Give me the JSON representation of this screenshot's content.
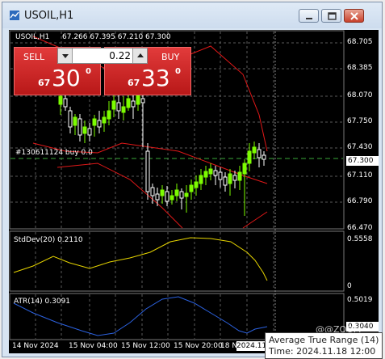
{
  "window": {
    "title": "USOIL,H1",
    "buttons": [
      "minimize",
      "restore",
      "close"
    ]
  },
  "chart_header": {
    "symbol": "USOIL,H1",
    "ohlc": "67.266 67.395 67.210 67.300",
    "position_label": "#130611124 buy 0.0"
  },
  "trade_panel": {
    "sell_label": "SELL",
    "buy_label": "BUY",
    "lot_value": "0.22",
    "sell_price": {
      "prefix": "67",
      "big": "30",
      "sup": "0"
    },
    "buy_price": {
      "prefix": "67",
      "big": "33",
      "sup": "0"
    }
  },
  "price_axis": {
    "labels": [
      "68.705",
      "68.385",
      "68.070",
      "67.750",
      "67.430",
      "67.110",
      "66.790",
      "66.470"
    ],
    "current": "67.300"
  },
  "stddev": {
    "label": "StdDev(20) 0.2110",
    "axis_top": "0.5558",
    "axis_bottom": "0"
  },
  "atr": {
    "label": "ATR(14) 0.3091",
    "axis_top": "0.5019",
    "axis_current": "0.3040"
  },
  "time_axis": {
    "labels": [
      "14 Nov 2024",
      "15 Nov 04:00",
      "15 Nov 12:00",
      "15 Nov 20:00",
      "18 N"
    ],
    "highlight": "2024.11.18 12:00"
  },
  "tooltip": {
    "line1": "Average True Range (14)",
    "line2": "Time: 2024.11.18 12:00"
  },
  "watermark": "@@ZOOM",
  "colors": {
    "bull": "#7CFC00",
    "bear": "#ffffff",
    "bands": "#e01818",
    "stddev": "#e6d400",
    "atr": "#2c62e0",
    "grid": "#5a5a5a",
    "trade_red": "#c82222"
  }
}
